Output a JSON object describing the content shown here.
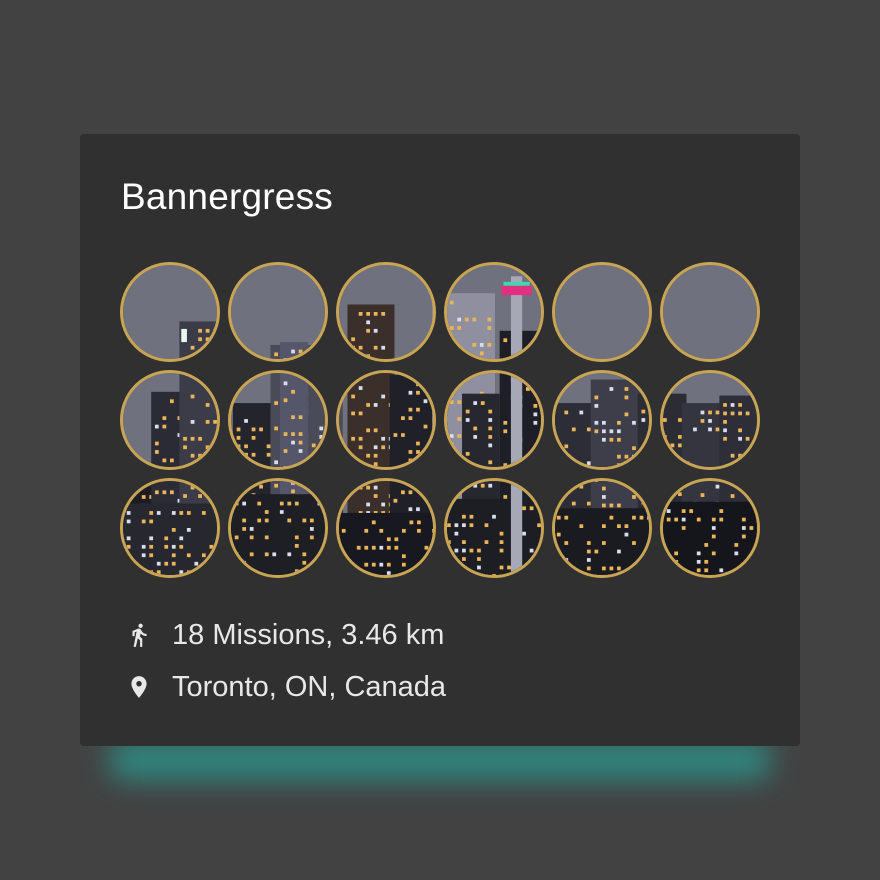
{
  "card": {
    "title": "Bannergress"
  },
  "banner": {
    "mission_count": 18,
    "columns": 6,
    "medal_border_color": "#c9a453",
    "image_subject": "Toronto skyline at night"
  },
  "info": {
    "missions_label": "18 Missions, 3.46 km",
    "missions_icon": "walking-person-icon",
    "location_label": "Toronto, ON, Canada",
    "location_icon": "map-pin-icon"
  },
  "colors": {
    "page_background": "#424242",
    "card_background": "#303030",
    "accent_glow": "#2f8f86",
    "text_primary": "#ffffff",
    "text_secondary": "#e8e8e8"
  }
}
